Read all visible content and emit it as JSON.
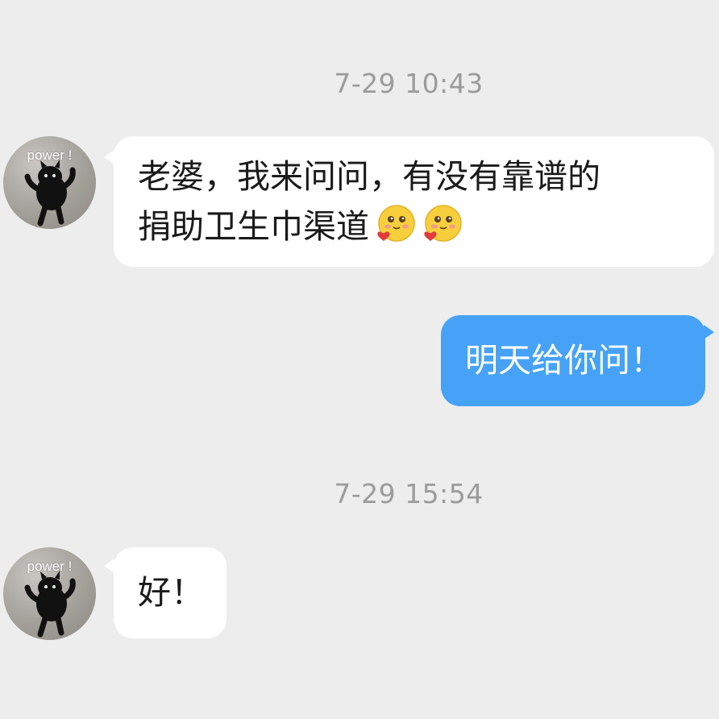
{
  "chat": {
    "messages": [
      {
        "timestamp": "7-29 10:43",
        "sender": "contact",
        "avatar_caption": "power !",
        "line1": "老婆，我来问问，有没有靠谱的",
        "line2": "捐助卫生巾渠道",
        "emojis": [
          "blush-heart-emoji",
          "blush-heart-emoji"
        ]
      },
      {
        "sender": "me",
        "text": "明天给你问！"
      },
      {
        "timestamp": "7-29 15:54",
        "sender": "contact",
        "avatar_caption": "power !",
        "text": "好！"
      }
    ]
  },
  "colors": {
    "background": "#ededed",
    "incoming_bubble": "#ffffff",
    "outgoing_bubble": "#46a2f7",
    "timestamp_text": "#9b9b9b"
  }
}
